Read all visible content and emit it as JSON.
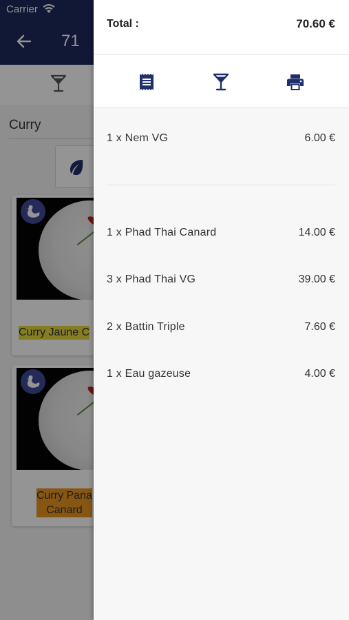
{
  "status_bar": {
    "carrier": "Carrier"
  },
  "header": {
    "title": "71"
  },
  "category": {
    "name": "Curry"
  },
  "products": [
    {
      "label": "Curry Jaune C",
      "highlight": "#e5d73a"
    },
    {
      "label_line1": "Curry Pana",
      "label_line2": "Canard",
      "highlight": "#e8941f"
    }
  ],
  "cart": {
    "total_label": "Total :",
    "total_value": "70.60 €",
    "actions": [
      {
        "icon": "receipt-icon"
      },
      {
        "icon": "cocktail-icon"
      },
      {
        "icon": "print-icon"
      }
    ],
    "groups": [
      {
        "items": [
          {
            "label": "1 x Nem VG",
            "price": "6.00 €"
          }
        ]
      },
      {
        "items": [
          {
            "label": "1 x Phad Thai Canard",
            "price": "14.00 €"
          },
          {
            "label": "3 x Phad Thai VG",
            "price": "39.00 €"
          },
          {
            "label": "2 x Battin Triple",
            "price": "7.60 €"
          },
          {
            "label": "1 x Eau gazeuse",
            "price": "4.00 €"
          }
        ]
      }
    ]
  },
  "colors": {
    "header": "#1c2a5c",
    "icon_accent": "#1e2f6b",
    "badge": "#3e4a9a"
  }
}
